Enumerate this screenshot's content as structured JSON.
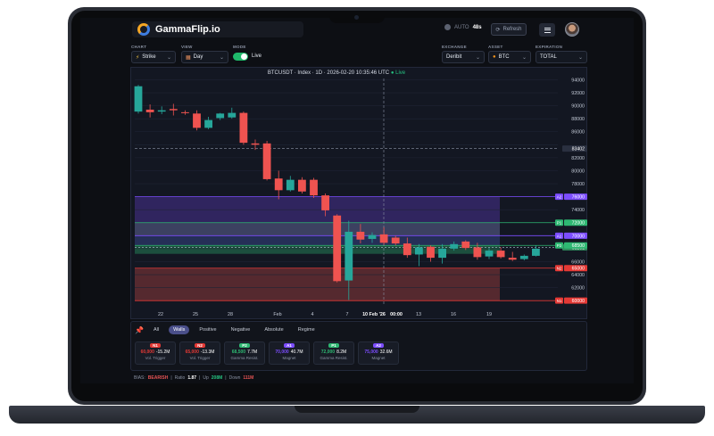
{
  "app": {
    "name": "GammaFlip.io",
    "auto_label": "AUTO",
    "auto_countdown": "48s",
    "refresh_label": "Refresh"
  },
  "controls": {
    "chart": {
      "label": "CHART",
      "value": "Strike"
    },
    "view": {
      "label": "VIEW",
      "value": "Day"
    },
    "mode": {
      "label": "MODE",
      "value": "Live",
      "on": true
    },
    "exchange": {
      "label": "EXCHANGE",
      "value": "Deribit"
    },
    "asset": {
      "label": "ASSET",
      "value": "BTC"
    },
    "expiration": {
      "label": "EXPIRATION",
      "value": "TOTAL"
    }
  },
  "chart_title": "BTCUSDT · Index · 1D · 2026-02-20 10:35:46 UTC",
  "chart_live": "● Live",
  "colors": {
    "up": "#26a69a",
    "down": "#ef5350",
    "negative_zone": "#ef5350",
    "accent_purple": "#7c4dff",
    "accent_green": "#2eb872",
    "accent_red": "#e53935"
  },
  "chart_data": {
    "type": "candlestick",
    "y_ticks": [
      60000,
      62000,
      64000,
      66000,
      68000,
      70000,
      72000,
      74000,
      76000,
      78000,
      80000,
      82000,
      84000,
      86000,
      88000,
      90000,
      92000,
      94000
    ],
    "ylim": [
      59200,
      94200
    ],
    "x_ticks": [
      "22",
      "25",
      "28",
      "Feb",
      "4",
      "7",
      "10 Feb '26",
      "00:00",
      "13",
      "16",
      "19"
    ],
    "current_price_label": "68201",
    "crosshair_price_label": "83402",
    "level_labels": [
      {
        "tag": "A2",
        "value": "76000"
      },
      {
        "tag": "P1",
        "value": "72000"
      },
      {
        "tag": "A1",
        "value": "70000"
      },
      {
        "tag": "P2",
        "value": "68500"
      },
      {
        "tag": "N2",
        "value": "65000"
      },
      {
        "tag": "N1",
        "value": "60000"
      }
    ],
    "candles": [
      {
        "o": 89100,
        "h": 93200,
        "l": 88800,
        "c": 93000
      },
      {
        "o": 89400,
        "h": 90200,
        "l": 88200,
        "c": 89000
      },
      {
        "o": 89100,
        "h": 89900,
        "l": 88700,
        "c": 89300
      },
      {
        "o": 89500,
        "h": 90300,
        "l": 88500,
        "c": 89300
      },
      {
        "o": 89000,
        "h": 89300,
        "l": 88600,
        "c": 88900
      },
      {
        "o": 88800,
        "h": 89300,
        "l": 86200,
        "c": 86600
      },
      {
        "o": 86600,
        "h": 88300,
        "l": 86400,
        "c": 87800
      },
      {
        "o": 88100,
        "h": 88900,
        "l": 87800,
        "c": 88800
      },
      {
        "o": 88200,
        "h": 89700,
        "l": 88000,
        "c": 88900
      },
      {
        "o": 88900,
        "h": 89100,
        "l": 84000,
        "c": 84300
      },
      {
        "o": 84200,
        "h": 84800,
        "l": 83200,
        "c": 84000
      },
      {
        "o": 84200,
        "h": 84600,
        "l": 78500,
        "c": 78700
      },
      {
        "o": 78800,
        "h": 80000,
        "l": 75600,
        "c": 77000
      },
      {
        "o": 77000,
        "h": 79200,
        "l": 76800,
        "c": 78600
      },
      {
        "o": 78600,
        "h": 79000,
        "l": 76500,
        "c": 76800
      },
      {
        "o": 78600,
        "h": 78900,
        "l": 75800,
        "c": 76200
      },
      {
        "o": 76200,
        "h": 76500,
        "l": 73000,
        "c": 73900
      },
      {
        "o": 73100,
        "h": 73300,
        "l": 62800,
        "c": 63000
      },
      {
        "o": 63100,
        "h": 72300,
        "l": 60100,
        "c": 70600
      },
      {
        "o": 70600,
        "h": 71800,
        "l": 68800,
        "c": 69400
      },
      {
        "o": 69500,
        "h": 70500,
        "l": 68900,
        "c": 70100
      },
      {
        "o": 70200,
        "h": 71300,
        "l": 68600,
        "c": 68900
      },
      {
        "o": 69700,
        "h": 70000,
        "l": 68500,
        "c": 68800
      },
      {
        "o": 68800,
        "h": 69700,
        "l": 66600,
        "c": 67000
      },
      {
        "o": 67100,
        "h": 68700,
        "l": 65300,
        "c": 68200
      },
      {
        "o": 68300,
        "h": 68500,
        "l": 66000,
        "c": 66600
      },
      {
        "o": 66600,
        "h": 68700,
        "l": 65700,
        "c": 68000
      },
      {
        "o": 68000,
        "h": 69100,
        "l": 67700,
        "c": 68700
      },
      {
        "o": 69100,
        "h": 69300,
        "l": 67800,
        "c": 68100
      },
      {
        "o": 68200,
        "h": 68900,
        "l": 66300,
        "c": 66700
      },
      {
        "o": 66800,
        "h": 68100,
        "l": 66400,
        "c": 67700
      },
      {
        "o": 67700,
        "h": 68200,
        "l": 66500,
        "c": 66700
      },
      {
        "o": 66600,
        "h": 67500,
        "l": 66100,
        "c": 66300
      },
      {
        "o": 66400,
        "h": 67100,
        "l": 66200,
        "c": 66900
      },
      {
        "o": 66900,
        "h": 68500,
        "l": 66800,
        "c": 68000
      }
    ]
  },
  "filters": [
    "All",
    "Walls",
    "Positive",
    "Negative",
    "Absolute",
    "Regime"
  ],
  "active_filter": "Walls",
  "levels": [
    {
      "tag": "N1",
      "strike": "60,000",
      "amount": "-15.2M",
      "desc": "Vol. Trigger",
      "color": "#e53935"
    },
    {
      "tag": "N2",
      "strike": "65,000",
      "amount": "-13.3M",
      "desc": "Vol. Trigger",
      "color": "#e53935"
    },
    {
      "tag": "P2",
      "strike": "68,500",
      "amount": "7.7M",
      "desc": "Gamma Resist.",
      "color": "#2eb872"
    },
    {
      "tag": "A1",
      "strike": "70,000",
      "amount": "40.7M",
      "desc": "Magnet",
      "color": "#7c4dff"
    },
    {
      "tag": "P1",
      "strike": "72,000",
      "amount": "8.2M",
      "desc": "Gamma Resist.",
      "color": "#2eb872"
    },
    {
      "tag": "A2",
      "strike": "75,000",
      "amount": "32.6M",
      "desc": "Magnet",
      "color": "#7c4dff"
    }
  ],
  "bias": {
    "label": "BIAS:",
    "value": "BEARISH",
    "ratio_label": "Ratio",
    "ratio_value": "1.87",
    "up_label": "Up",
    "up_value": "208M",
    "down_label": "Down",
    "down_value": "111M"
  }
}
